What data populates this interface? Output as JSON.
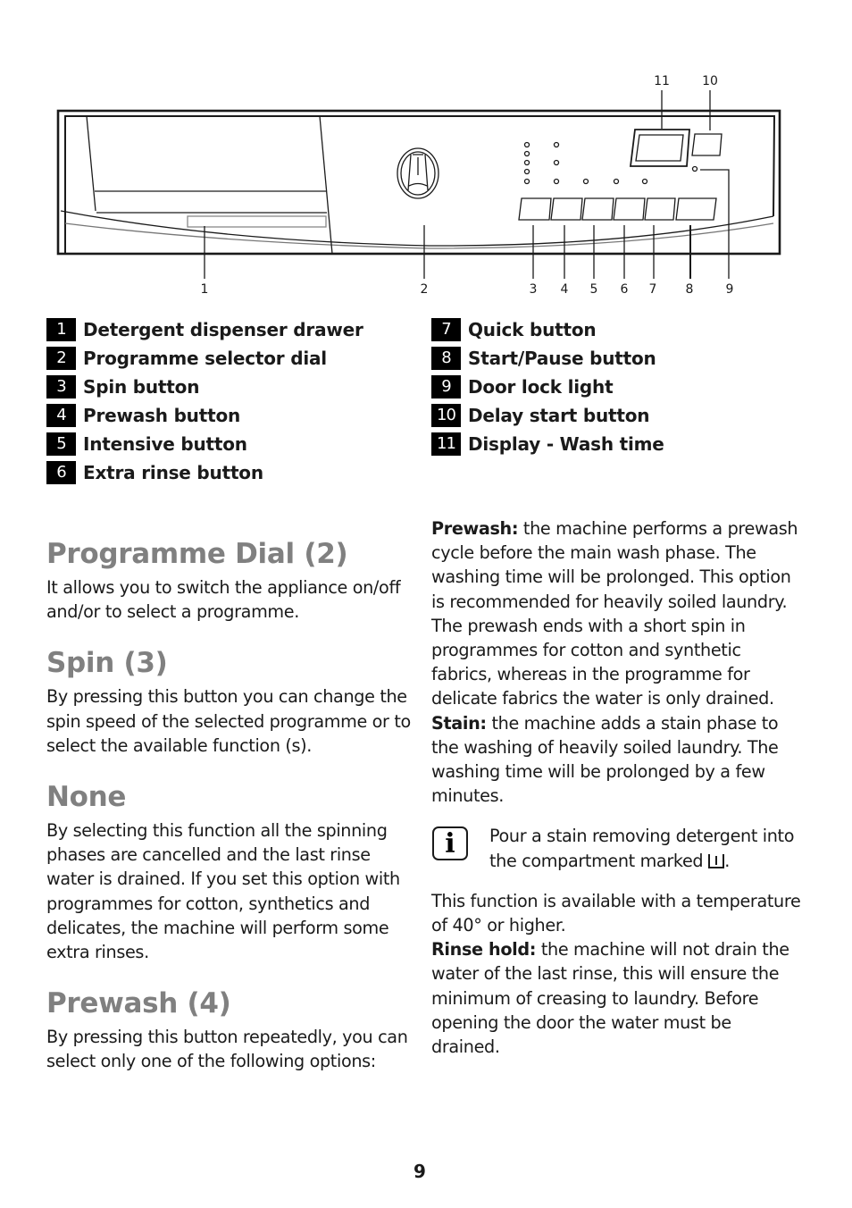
{
  "diagram": {
    "callouts": [
      "1",
      "2",
      "3",
      "4",
      "5",
      "6",
      "7",
      "8",
      "9",
      "10",
      "11"
    ]
  },
  "legend": {
    "left": [
      {
        "num": "1",
        "label": "Detergent dispenser drawer"
      },
      {
        "num": "2",
        "label": "Programme selector dial"
      },
      {
        "num": "3",
        "label": "Spin button"
      },
      {
        "num": "4",
        "label": "Prewash button"
      },
      {
        "num": "5",
        "label": "Intensive button"
      },
      {
        "num": "6",
        "label": "Extra rinse button"
      }
    ],
    "right": [
      {
        "num": "7",
        "label": "Quick button"
      },
      {
        "num": "8",
        "label": "Start/Pause button"
      },
      {
        "num": "9",
        "label": "Door lock light"
      },
      {
        "num": "10",
        "label": "Delay start button"
      },
      {
        "num": "11",
        "label": "Display - Wash time"
      }
    ]
  },
  "sections": {
    "programme_dial": {
      "title": "Programme Dial (2)",
      "body": "It allows you to switch the appliance on/off and/or to select a programme."
    },
    "spin": {
      "title": "Spin (3)",
      "body": "By pressing this button you can change the spin speed of the selected programme or to select the available function (s)."
    },
    "none": {
      "title": "None",
      "body": "By selecting this function all the spinning phases are cancelled and the last rinse water is drained. If you set this option with programmes for cotton, synthetics and delicates, the machine will perform some extra rinses."
    },
    "prewash": {
      "title": "Prewash (4)",
      "body": "By pressing this button repeatedly, you can select only one of the following options:"
    }
  },
  "options": {
    "prewash": {
      "label": "Prewash:",
      "text": " the machine performs a prewash cycle before the main wash phase. The washing time will be prolonged. This option is recommended for heavily soiled laundry. The prewash ends with a short spin in programmes for cotton and synthetic fabrics, whereas in the programme for delicate fabrics the water is only drained."
    },
    "stain": {
      "label": "Stain:",
      "text": " the machine adds a stain phase to the washing of heavily soiled laundry. The washing time will be prolonged by a few minutes."
    },
    "note": {
      "icon": "info-icon",
      "text": "Pour a stain removing detergent into the compartment marked",
      "suffix": "."
    },
    "temperature": {
      "text": "This function is available with a temperature of 40° or higher."
    },
    "rinse_hold": {
      "label": "Rinse hold:",
      "text": " the machine will not drain the water of the last rinse, this will ensure the minimum of creasing to laundry. Before opening the door the water must be drained."
    }
  },
  "page_number": "9"
}
